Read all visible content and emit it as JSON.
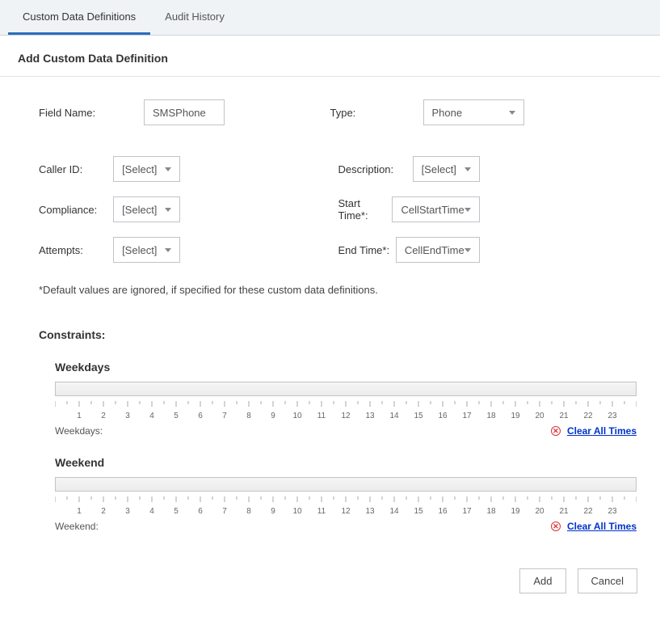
{
  "tabs": {
    "custom": "Custom Data Definitions",
    "audit": "Audit History"
  },
  "section_title": "Add Custom Data Definition",
  "labels": {
    "field_name": "Field Name:",
    "type": "Type:",
    "caller_id": "Caller ID:",
    "description": "Description:",
    "compliance": "Compliance:",
    "start_time": "Start Time*:",
    "attempts": "Attempts:",
    "end_time": "End Time*:"
  },
  "values": {
    "field_name": "SMSPhone",
    "type": "Phone",
    "caller_id": "[Select]",
    "description": "[Select]",
    "compliance": "[Select]",
    "start_time": "CellStartTime",
    "attempts": "[Select]",
    "end_time": "CellEndTime"
  },
  "note": "*Default values are ignored, if specified for these custom data definitions.",
  "constraints_title": "Constraints:",
  "weekdays": {
    "title": "Weekdays",
    "label": "Weekdays:",
    "clear": "Clear All Times"
  },
  "weekend": {
    "title": "Weekend",
    "label": "Weekend:",
    "clear": "Clear All Times"
  },
  "hours": [
    "1",
    "2",
    "3",
    "4",
    "5",
    "6",
    "7",
    "8",
    "9",
    "10",
    "11",
    "12",
    "13",
    "14",
    "15",
    "16",
    "17",
    "18",
    "19",
    "20",
    "21",
    "22",
    "23"
  ],
  "buttons": {
    "add": "Add",
    "cancel": "Cancel"
  }
}
